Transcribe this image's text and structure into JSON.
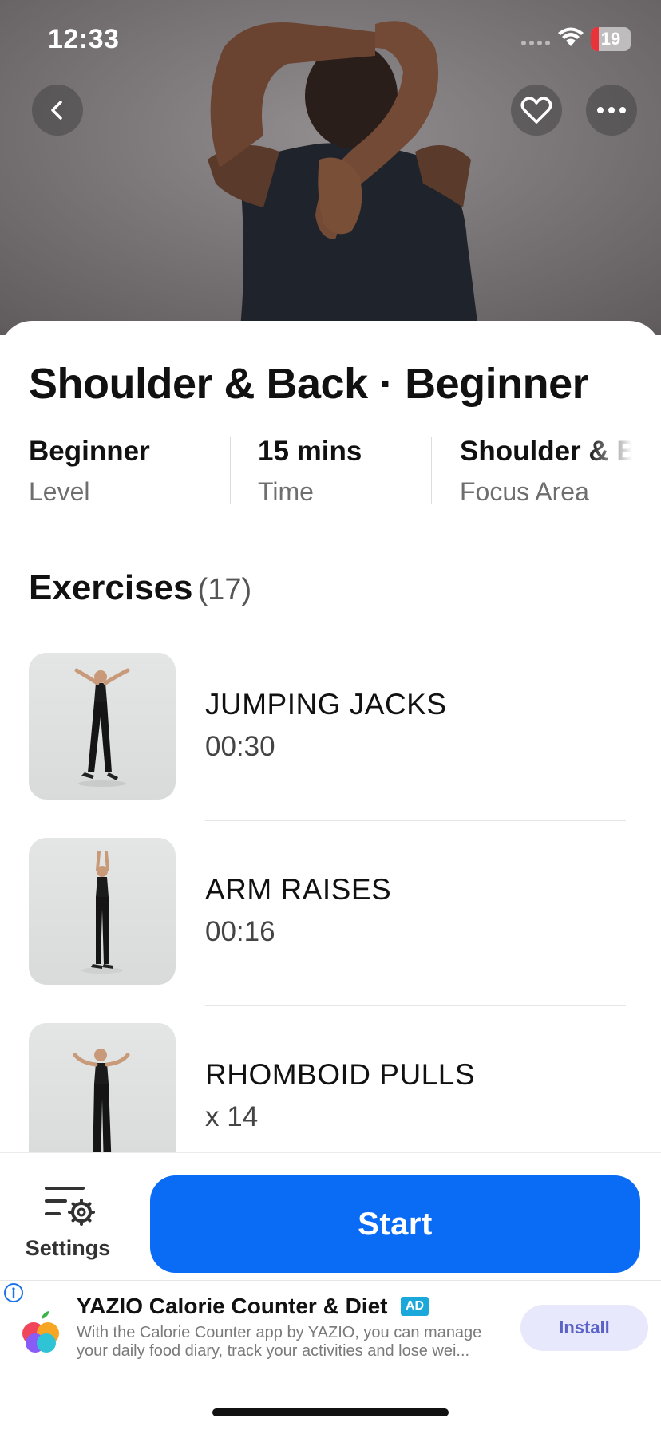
{
  "status_bar": {
    "time": "12:33",
    "battery_level": "19"
  },
  "header": {
    "back_icon": "chevron-left-icon",
    "favorite_icon": "heart-icon",
    "more_icon": "ellipsis-icon"
  },
  "workout": {
    "title": "Shoulder & Back · Beginner",
    "stats": [
      {
        "value": "Beginner",
        "label": "Level"
      },
      {
        "value": "15 mins",
        "label": "Time"
      },
      {
        "value": "Shoulder & Back",
        "label": "Focus Area"
      }
    ]
  },
  "exercises": {
    "heading": "Exercises",
    "count": "(17)",
    "items": [
      {
        "name": "JUMPING JACKS",
        "meta": "00:30"
      },
      {
        "name": "ARM RAISES",
        "meta": "00:16"
      },
      {
        "name": "RHOMBOID PULLS",
        "meta": "x 14"
      }
    ]
  },
  "bottom_bar": {
    "settings_label": "Settings",
    "start_label": "Start"
  },
  "ad": {
    "title": "YAZIO Calorie Counter & Diet",
    "badge": "AD",
    "description_line1": "With the Calorie Counter app by YAZIO, you can manage",
    "description_line2": "your daily food diary, track your activities and lose wei...",
    "install_label": "Install"
  },
  "colors": {
    "accent": "#0a6cf5",
    "install_bg": "#e7e8fb",
    "battery_low": "#e8333a"
  }
}
